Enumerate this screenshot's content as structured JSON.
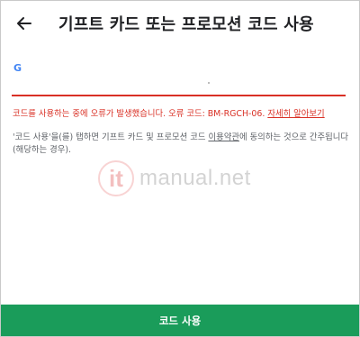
{
  "header": {
    "title": "기프트 카드 또는 프로모션 코드 사용"
  },
  "form": {
    "google_mark": "G",
    "code_value": ""
  },
  "error": {
    "message": "코드를 사용하는 중에 오류가 발생했습니다. 오류 코드: BM-RGCH-06. ",
    "link": "자세히 알아보기"
  },
  "terms": {
    "before": "'코드 사용'을(를) 탭하면 기프트 카드 및 프로모션 코드 ",
    "link": "이용약관",
    "after": "에 동의하는 것으로 간주됩니다(해당하는 경우)."
  },
  "watermark": {
    "badge": "it",
    "text": "manual.net"
  },
  "footer": {
    "button_label": "코드 사용"
  },
  "colors": {
    "error": "#d93025",
    "primary": "#1a9c5a"
  }
}
